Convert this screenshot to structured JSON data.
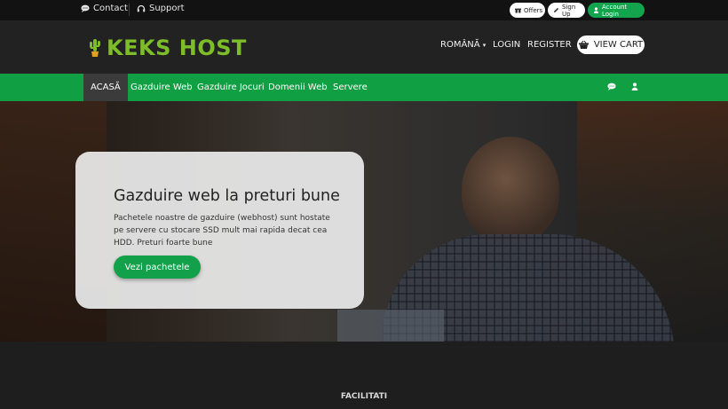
{
  "topbar": {
    "contact_label": "Contact",
    "support_label": "Support",
    "offers_label": "Offers",
    "signup_label": "Sign Up",
    "account_login_label": "Account Login"
  },
  "header": {
    "logo_text": "KEKS HOST",
    "language_label": "ROMÂNĂ",
    "login_label": "LOGIN",
    "register_label": "REGISTER",
    "view_cart_label": "VIEW CART"
  },
  "nav": {
    "items": [
      {
        "label": "ACASĂ"
      },
      {
        "label": "Gazduire Web"
      },
      {
        "label": "Gazduire Jocuri"
      },
      {
        "label": "Domenii Web"
      },
      {
        "label": "Servere"
      }
    ]
  },
  "hero": {
    "title": "Gazduire web la preturi bune",
    "description": "Pachetele noastre de gazduire (webhost) sunt hostate pe servere cu stocare SSD mult mai rapida decat cea HDD. Preturi foarte bune",
    "button_label": "Vezi pachetele"
  },
  "section": {
    "title": "FACILITATI"
  },
  "colors": {
    "brand_green": "#10a043",
    "logo_green": "#7dbd2a",
    "dark": "#222222"
  }
}
